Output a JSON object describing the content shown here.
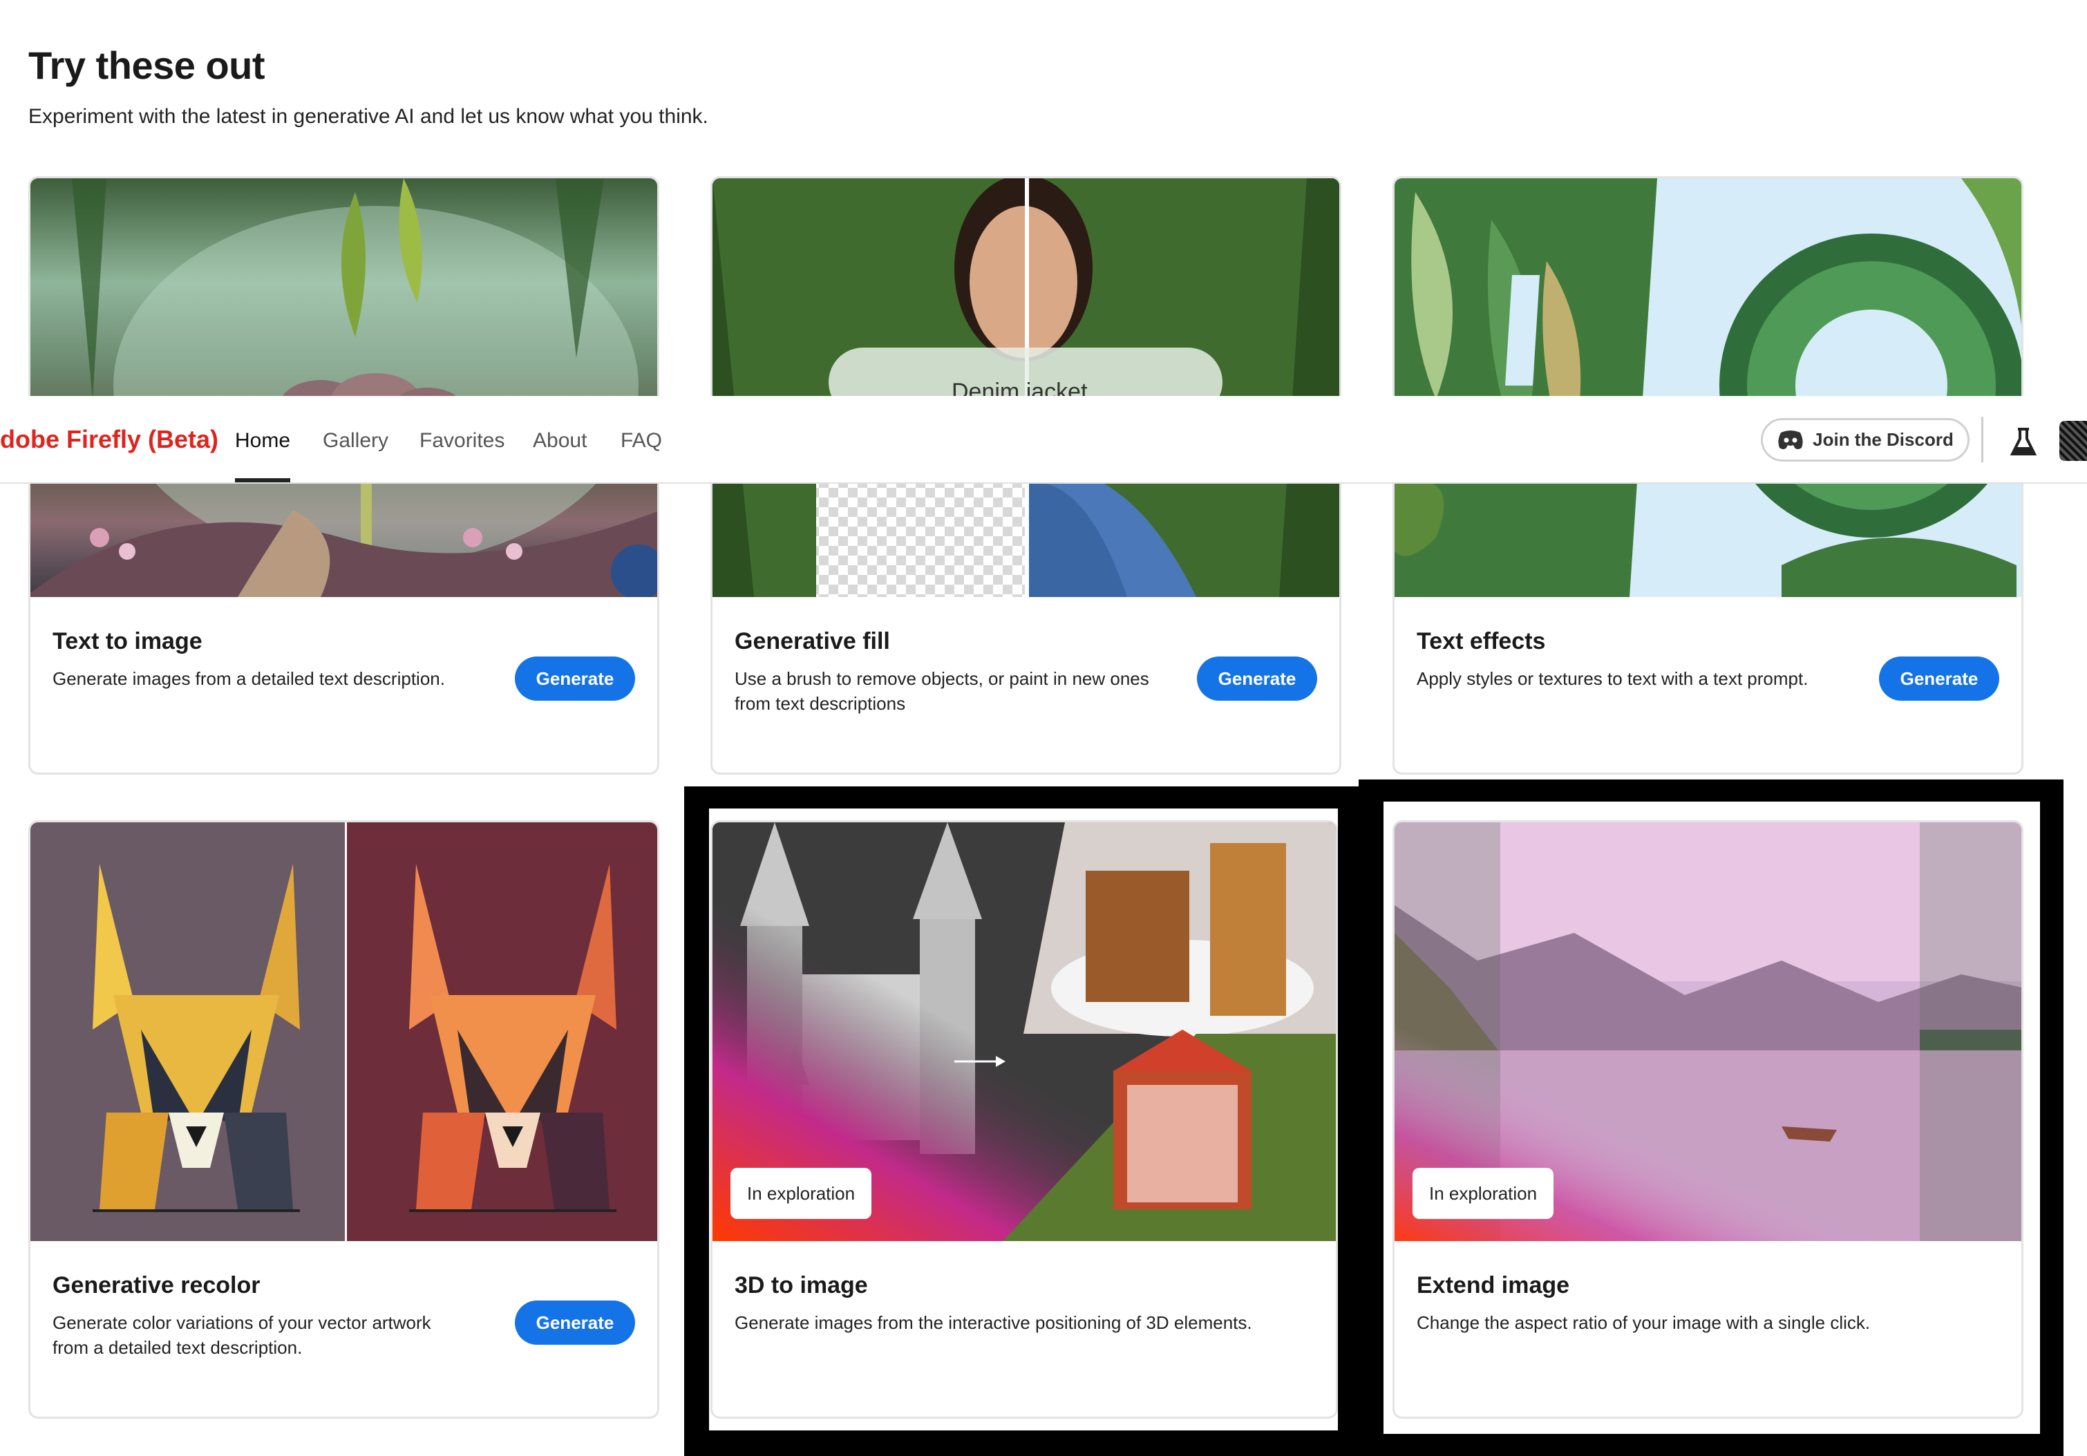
{
  "section": {
    "title": "Try these out",
    "subtitle": "Experiment with the latest in generative AI and let us know what you think."
  },
  "nav": {
    "brand": "dobe Firefly (Beta)",
    "links": [
      "Home",
      "Gallery",
      "Favorites",
      "About",
      "FAQ"
    ],
    "active": "Home",
    "discord_label": "Join the Discord",
    "icons": [
      "discord-icon",
      "flask-icon",
      "avatar"
    ]
  },
  "cards": [
    {
      "title": "Text to image",
      "desc": "Generate images from a detailed text description.",
      "button": "Generate"
    },
    {
      "title": "Generative fill",
      "desc": "Use a brush to remove objects, or paint in new ones from text descriptions",
      "button": "Generate",
      "overlay_text": "Denim jacket"
    },
    {
      "title": "Text effects",
      "desc": "Apply styles or textures to text with a text prompt.",
      "button": "Generate"
    },
    {
      "title": "Generative recolor",
      "desc": "Generate color variations of your vector artwork from a detailed text description.",
      "button": "Generate"
    },
    {
      "title": "3D to image",
      "desc": "Generate images from the interactive positioning of 3D elements.",
      "badge": "In exploration"
    },
    {
      "title": "Extend image",
      "desc": "Change the aspect ratio of your image with a single click.",
      "badge": "In exploration"
    }
  ],
  "colors": {
    "accent": "#1473e6",
    "brand": "#e0231c"
  }
}
